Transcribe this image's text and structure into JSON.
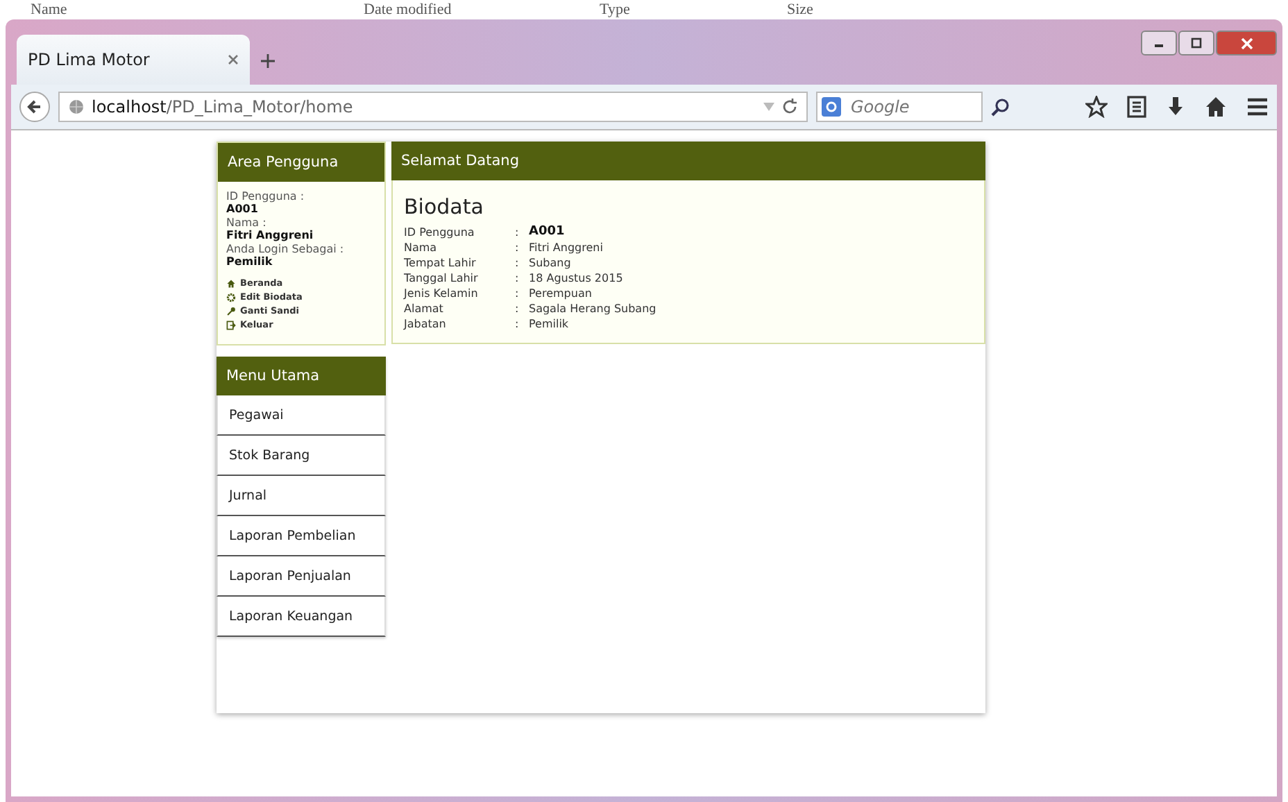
{
  "background_window": {
    "columns": [
      "Name",
      "Date modified",
      "Type",
      "Size"
    ]
  },
  "browser": {
    "tab": {
      "title": "PD Lima Motor"
    },
    "address": {
      "host": "localhost",
      "path": "/PD_Lima_Motor/home"
    },
    "search": {
      "placeholder": "Google"
    }
  },
  "sidebar": {
    "user_panel": {
      "title": "Area Pengguna",
      "fields": [
        {
          "label": "ID Pengguna :",
          "value": "A001"
        },
        {
          "label": "Nama :",
          "value": "Fitri Anggreni"
        },
        {
          "label": "Anda Login Sebagai :",
          "value": "Pemilik"
        }
      ],
      "links": [
        {
          "label": "Beranda",
          "kind": "home"
        },
        {
          "label": "Edit Biodata",
          "kind": "gear"
        },
        {
          "label": "Ganti Sandi",
          "kind": "key"
        },
        {
          "label": "Keluar",
          "kind": "exit"
        }
      ]
    },
    "menu": {
      "title": "Menu Utama",
      "items": [
        "Pegawai",
        "Stok Barang",
        "Jurnal",
        "Laporan Pembelian",
        "Laporan Penjualan",
        "Laporan Keuangan"
      ]
    }
  },
  "main": {
    "header": "Selamat Datang",
    "heading": "Biodata",
    "rows": [
      {
        "label": "ID Pengguna",
        "separator": ":",
        "value": "A001",
        "bold": true
      },
      {
        "label": "Nama",
        "separator": ":",
        "value": "Fitri Anggreni",
        "bold": false
      },
      {
        "label": "Tempat Lahir",
        "separator": ":",
        "value": "Subang",
        "bold": false
      },
      {
        "label": "Tanggal Lahir",
        "separator": ":",
        "value": "18 Agustus 2015",
        "bold": false
      },
      {
        "label": "Jenis Kelamin",
        "separator": ":",
        "value": "Perempuan",
        "bold": false
      },
      {
        "label": "Alamat",
        "separator": ":",
        "value": "Sagala Herang Subang",
        "bold": false
      },
      {
        "label": "Jabatan",
        "separator": ":",
        "value": "Pemilik",
        "bold": false
      }
    ]
  }
}
